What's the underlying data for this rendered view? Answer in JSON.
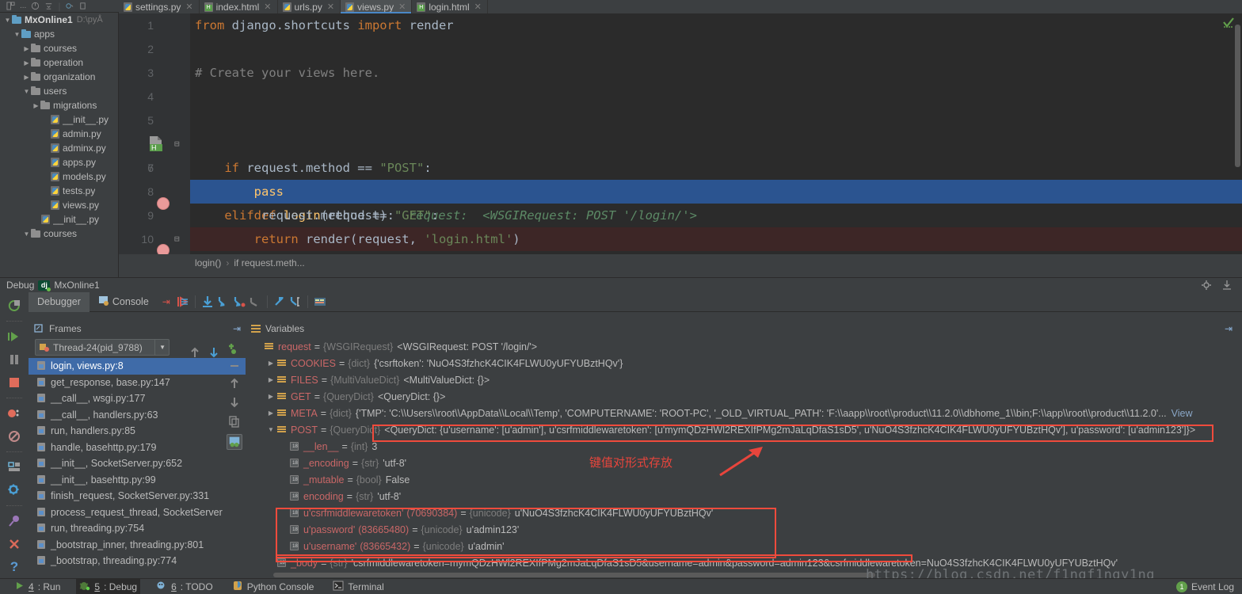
{
  "window": {
    "title": "MxOnline1 - views.py"
  },
  "editor_tabs": [
    {
      "label": "settings.py",
      "icon": "python-file-icon",
      "type": "py",
      "active": false
    },
    {
      "label": "index.html",
      "icon": "html-file-icon",
      "type": "html",
      "active": false
    },
    {
      "label": "urls.py",
      "icon": "python-file-icon",
      "type": "py",
      "active": false
    },
    {
      "label": "views.py",
      "icon": "python-file-icon",
      "type": "py",
      "active": true
    },
    {
      "label": "login.html",
      "icon": "html-file-icon",
      "type": "html",
      "active": false
    }
  ],
  "project_tree": [
    {
      "label": "MxOnline1",
      "path": "D:\\pyÅ",
      "indent": 0,
      "arrow": "down",
      "icon": "folder-icon-blue",
      "bold": true
    },
    {
      "label": "apps",
      "path": "",
      "indent": 1,
      "arrow": "down",
      "icon": "folder-icon-blue",
      "bold": false
    },
    {
      "label": "courses",
      "path": "",
      "indent": 2,
      "arrow": "right",
      "icon": "folder-icon-grey",
      "bold": false
    },
    {
      "label": "operation",
      "path": "",
      "indent": 2,
      "arrow": "right",
      "icon": "folder-icon-grey",
      "bold": false
    },
    {
      "label": "organization",
      "path": "",
      "indent": 2,
      "arrow": "right",
      "icon": "folder-icon-grey",
      "bold": false
    },
    {
      "label": "users",
      "path": "",
      "indent": 2,
      "arrow": "down",
      "icon": "folder-icon-grey",
      "bold": false
    },
    {
      "label": "migrations",
      "path": "",
      "indent": 3,
      "arrow": "right",
      "icon": "folder-icon-grey",
      "bold": false
    },
    {
      "label": "__init__.py",
      "path": "",
      "indent": 4,
      "arrow": "none",
      "icon": "python-file-icon",
      "bold": false
    },
    {
      "label": "admin.py",
      "path": "",
      "indent": 4,
      "arrow": "none",
      "icon": "python-file-icon",
      "bold": false
    },
    {
      "label": "adminx.py",
      "path": "",
      "indent": 4,
      "arrow": "none",
      "icon": "python-file-icon",
      "bold": false
    },
    {
      "label": "apps.py",
      "path": "",
      "indent": 4,
      "arrow": "none",
      "icon": "python-file-icon",
      "bold": false
    },
    {
      "label": "models.py",
      "path": "",
      "indent": 4,
      "arrow": "none",
      "icon": "python-file-icon",
      "bold": false
    },
    {
      "label": "tests.py",
      "path": "",
      "indent": 4,
      "arrow": "none",
      "icon": "python-file-icon",
      "bold": false
    },
    {
      "label": "views.py",
      "path": "",
      "indent": 4,
      "arrow": "none",
      "icon": "python-file-icon",
      "bold": false
    },
    {
      "label": "__init__.py",
      "path": "",
      "indent": 3,
      "arrow": "none",
      "icon": "python-file-icon",
      "bold": false
    },
    {
      "label": "courses",
      "path": "",
      "indent": 2,
      "arrow": "down",
      "icon": "folder-icon-grey",
      "bold": false
    }
  ],
  "code_lines": [
    {
      "num": "1",
      "breakpoint": false,
      "highlight": "none"
    },
    {
      "num": "2",
      "breakpoint": false,
      "highlight": "none"
    },
    {
      "num": "3",
      "breakpoint": false,
      "highlight": "none"
    },
    {
      "num": "4",
      "breakpoint": false,
      "highlight": "none"
    },
    {
      "num": "5",
      "breakpoint": false,
      "highlight": "none"
    },
    {
      "num": "6",
      "breakpoint": false,
      "highlight": "none"
    },
    {
      "num": "7",
      "breakpoint": false,
      "highlight": "none"
    },
    {
      "num": "8",
      "breakpoint": true,
      "highlight": "current"
    },
    {
      "num": "9",
      "breakpoint": false,
      "highlight": "none"
    },
    {
      "num": "10",
      "breakpoint": true,
      "highlight": "error"
    }
  ],
  "code_text": {
    "l1_from": "from",
    "l1_module": " django.shortcuts ",
    "l1_import": "import",
    "l1_render": " render",
    "l3_comment": "# Create your views here.",
    "l6_def": "def",
    "l6_name": " login",
    "l6_args": "(request):",
    "l6_hint": "request:  <WSGIRequest: POST '/login/'>",
    "l7_if": "if",
    "l7_expr": " request.method == ",
    "l7_str": "\"POST\"",
    "l7_colon": ":",
    "l8_pass": "pass",
    "l9_elif": "elif",
    "l9_expr": " request.method == ",
    "l9_str": "\"GET\"",
    "l9_colon": ":",
    "l10_return": "return",
    "l10_call": " render(request, ",
    "l10_str": "'login.html'",
    "l10_close": ")"
  },
  "breadcrumb": {
    "fn": "login()",
    "sep": "›",
    "stmt": "if request.meth..."
  },
  "debug_header": {
    "label": "Debug",
    "framework_icon": "django-icon",
    "config": "MxOnline1"
  },
  "debug_tabs": [
    {
      "label": "Debugger",
      "active": true,
      "icon": "debugger-icon"
    },
    {
      "label": "Console",
      "active": false,
      "icon": "console-icon"
    }
  ],
  "debug_toolbar_buttons": [
    "show-execution-point-icon",
    "step-over-icon",
    "step-into-icon",
    "force-step-into-icon",
    "step-out-icon",
    "run-to-cursor-icon",
    "evaluate-expression-icon",
    "mute-breakpoints-icon"
  ],
  "vertical_toolbar_buttons": [
    "rerun-icon",
    "resume-program-icon",
    "pause-program-icon",
    "stop-icon",
    "view-breakpoints-icon",
    "mute-breakpoints-icon",
    "settings-layout-icon",
    "settings-gear-icon",
    "pin-icon",
    "close-icon",
    "help-icon"
  ],
  "frames": {
    "header": "Frames",
    "thread": "Thread-24(pid_9788)",
    "items": [
      {
        "label": "login, views.py:8",
        "selected": true
      },
      {
        "label": "get_response, base.py:147",
        "selected": false
      },
      {
        "label": "__call__, wsgi.py:177",
        "selected": false
      },
      {
        "label": "__call__, handlers.py:63",
        "selected": false
      },
      {
        "label": "run, handlers.py:85",
        "selected": false
      },
      {
        "label": "handle, basehttp.py:179",
        "selected": false
      },
      {
        "label": "__init__, SocketServer.py:652",
        "selected": false
      },
      {
        "label": "__init__, basehttp.py:99",
        "selected": false
      },
      {
        "label": "finish_request, SocketServer.py:331",
        "selected": false
      },
      {
        "label": "process_request_thread, SocketServer",
        "selected": false
      },
      {
        "label": "run, threading.py:754",
        "selected": false
      },
      {
        "label": "_bootstrap_inner, threading.py:801",
        "selected": false
      },
      {
        "label": "_bootstrap, threading.py:774",
        "selected": false
      }
    ]
  },
  "variables": {
    "header": "Variables",
    "rows": [
      {
        "twisty": "none",
        "icon": "dict",
        "name": "request",
        "type": "{WSGIRequest}",
        "value": "<WSGIRequest: POST '/login/'>",
        "indent": 0,
        "id": "",
        "view": false
      },
      {
        "twisty": "right",
        "icon": "dict",
        "name": "COOKIES",
        "type": "{dict}",
        "value": "{'csrftoken': 'NuO4S3fzhcK4CIK4FLWU0yUFYUBztHQv'}",
        "indent": 1,
        "id": "",
        "view": false
      },
      {
        "twisty": "right",
        "icon": "dict",
        "name": "FILES",
        "type": "{MultiValueDict}",
        "value": "<MultiValueDict: {}>",
        "indent": 1,
        "id": "",
        "view": false
      },
      {
        "twisty": "right",
        "icon": "dict",
        "name": "GET",
        "type": "{QueryDict}",
        "value": "<QueryDict: {}>",
        "indent": 1,
        "id": "",
        "view": false
      },
      {
        "twisty": "right",
        "icon": "dict",
        "name": "META",
        "type": "{dict}",
        "value": "{'TMP': 'C:\\\\Users\\\\root\\\\AppData\\\\Local\\\\Temp', 'COMPUTERNAME': 'ROOT-PC', '_OLD_VIRTUAL_PATH': 'F:\\\\aapp\\\\root\\\\product\\\\11.2.0\\\\dbhome_1\\\\bin;F:\\\\app\\\\root\\\\product\\\\11.2.0'...",
        "indent": 1,
        "id": "",
        "view": true
      },
      {
        "twisty": "down",
        "icon": "dict",
        "name": "POST",
        "type": "{QueryDict}",
        "value": "<QueryDict: {u'username': [u'admin'], u'csrfmiddlewaretoken': [u'mymQDzHWl2REXIfPMg2mJaLqDfaS1sD5', u'NuO4S3fzhcK4CIK4FLWU0yUFYUBztHQv'], u'password': [u'admin123']}>",
        "indent": 1,
        "id": "",
        "view": false
      },
      {
        "twisty": "none",
        "icon": "prim",
        "name": "__len__",
        "type": "{int}",
        "value": "3",
        "indent": 2,
        "id": "",
        "view": false
      },
      {
        "twisty": "none",
        "icon": "prim",
        "name": "_encoding",
        "type": "{str}",
        "value": "'utf-8'",
        "indent": 2,
        "id": "",
        "view": false
      },
      {
        "twisty": "none",
        "icon": "prim",
        "name": "_mutable",
        "type": "{bool}",
        "value": "False",
        "indent": 2,
        "id": "",
        "view": false
      },
      {
        "twisty": "none",
        "icon": "prim",
        "name": "encoding",
        "type": "{str}",
        "value": "'utf-8'",
        "indent": 2,
        "id": "",
        "view": false
      },
      {
        "twisty": "none",
        "icon": "prim",
        "name": "u'csrfmiddlewaretoken'",
        "type": "{unicode}",
        "value": "u'NuO4S3fzhcK4CIK4FLWU0yUFYUBztHQv'",
        "indent": 2,
        "id": "(70690384)",
        "view": false
      },
      {
        "twisty": "none",
        "icon": "prim",
        "name": "u'password'",
        "type": "{unicode}",
        "value": "u'admin123'",
        "indent": 2,
        "id": "(83665480)",
        "view": false
      },
      {
        "twisty": "none",
        "icon": "prim",
        "name": "u'username'",
        "type": "{unicode}",
        "value": "u'admin'",
        "indent": 2,
        "id": "(83665432)",
        "view": false
      },
      {
        "twisty": "none",
        "icon": "prim",
        "name": "_body",
        "type": "{str}",
        "value": "'csrfmiddlewaretoken=mymQDzHWl2REXIfPMg2mJaLqDfaS1sD5&username=admin&password=admin123&csrfmiddlewaretoken=NuO4S3fzhcK4CIK4FLWU0yUFYUBztHQv'",
        "indent": 1,
        "id": "",
        "view": false
      }
    ]
  },
  "annotations": {
    "chinese_note": "键值对形式存放",
    "highlight_color": "#f04b3c"
  },
  "status_bar": {
    "items": [
      {
        "num": "4",
        "label": ": Run",
        "icon": "run-icon",
        "active": false
      },
      {
        "num": "5",
        "label": ": Debug",
        "icon": "debug-bug-icon",
        "active": true
      },
      {
        "num": "6",
        "label": ": TODO",
        "icon": "todo-icon",
        "active": false
      },
      {
        "num": "",
        "label": "Python Console",
        "icon": "python-console-icon",
        "active": false
      },
      {
        "num": "",
        "label": "Terminal",
        "icon": "terminal-icon",
        "active": false
      }
    ],
    "event_log": "Event Log",
    "event_count": "1"
  },
  "watermark": "https://blog.csdn.net/f1ngf1ngy1ng"
}
